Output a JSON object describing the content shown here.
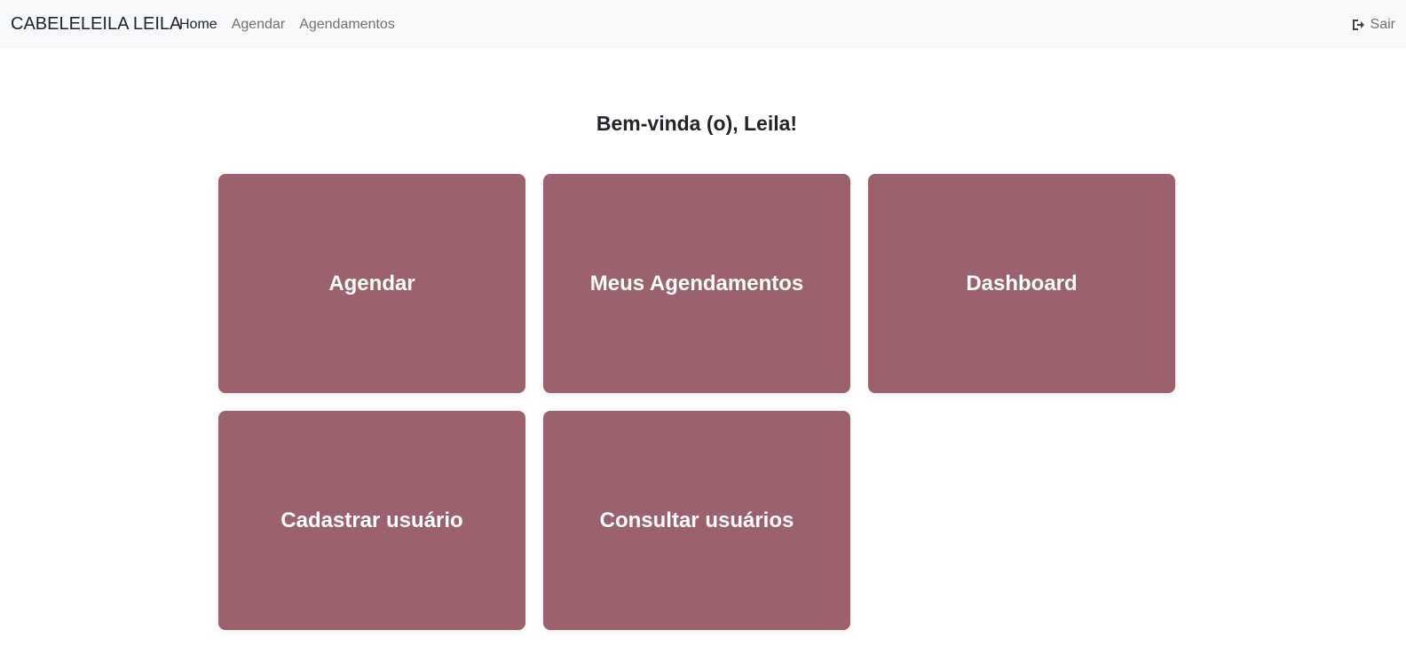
{
  "navbar": {
    "brand": "CABELELEILA LEILA",
    "links": [
      {
        "label": "Home",
        "active": true
      },
      {
        "label": "Agendar",
        "active": false
      },
      {
        "label": "Agendamentos",
        "active": false
      }
    ],
    "logout": {
      "label": "Sair",
      "icon": "sign-out-icon"
    }
  },
  "main": {
    "welcome": "Bem-vinda (o), Leila!",
    "tiles": [
      {
        "label": "Agendar"
      },
      {
        "label": "Meus Agendamentos"
      },
      {
        "label": "Dashboard"
      },
      {
        "label": "Cadastrar usuário"
      },
      {
        "label": "Consultar usuários"
      }
    ]
  },
  "colors": {
    "tile_background": "#9b616c",
    "navbar_background": "#f8f9fa",
    "tile_text": "#ffffff"
  }
}
